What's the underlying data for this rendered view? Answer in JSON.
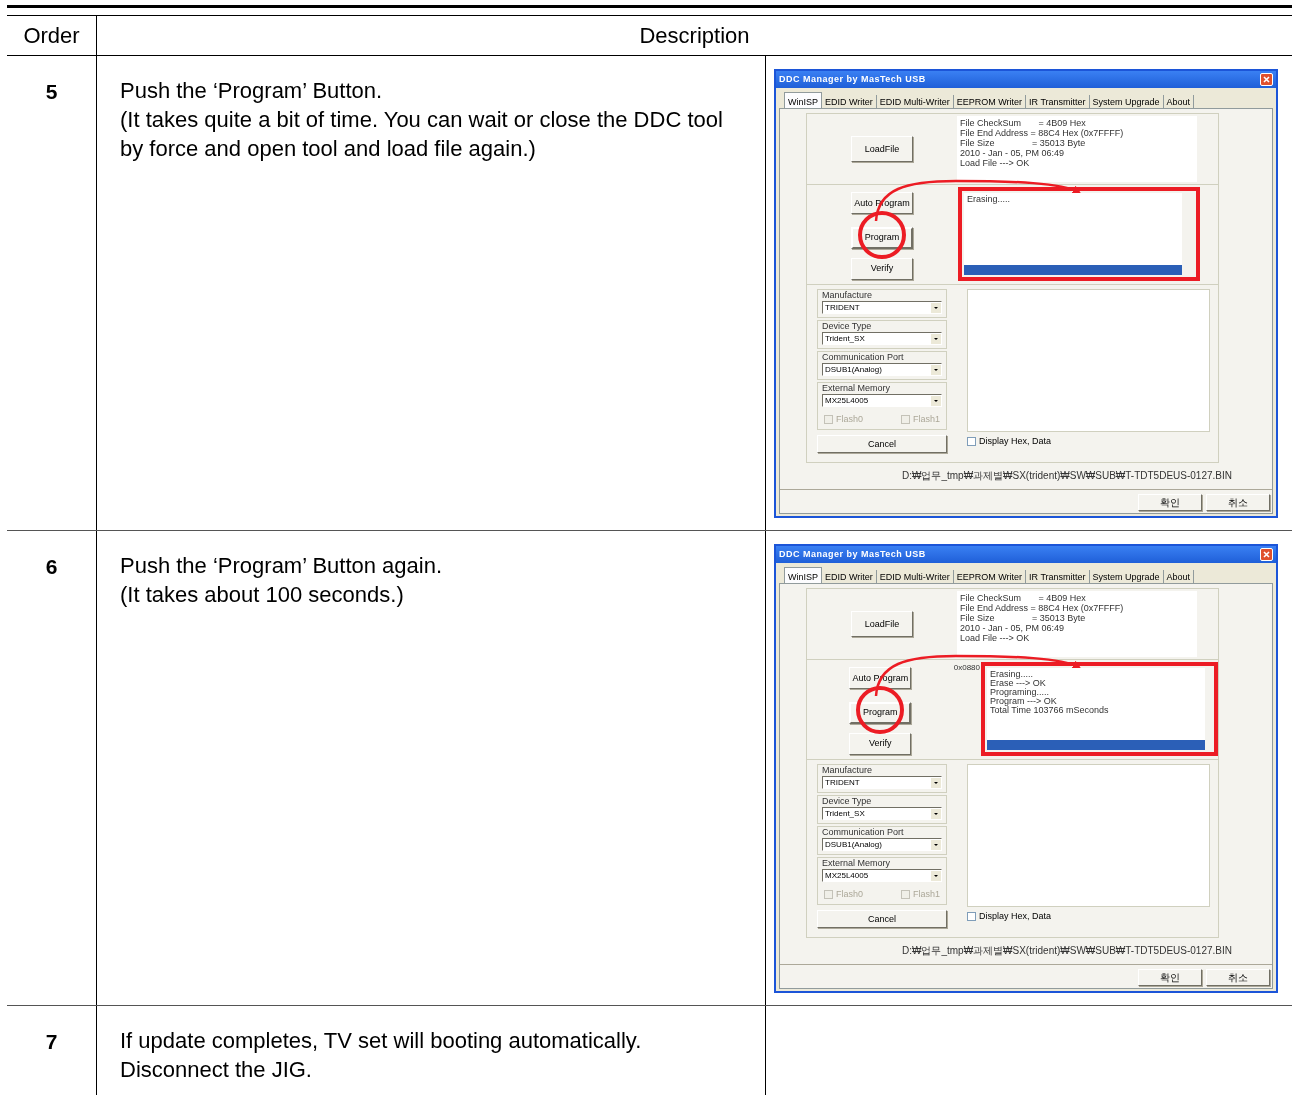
{
  "table": {
    "columns": [
      "Order",
      "Description"
    ],
    "rows": [
      {
        "order": "5",
        "paragraphs": [
          "Push the ‘Program’ Button.",
          "(It takes quite a bit of time. You can wait or close the DDC tool by force and open tool and load file again.)"
        ],
        "dialog": {
          "title": "DDC Manager by MasTech USB",
          "tabs": [
            {
              "label": "WinISP",
              "selected": true
            },
            {
              "label": "EDID Writer",
              "selected": false
            },
            {
              "label": "EDID Multi-Writer",
              "selected": false
            },
            {
              "label": "EEPROM Writer",
              "selected": false
            },
            {
              "label": "IR Transmitter",
              "selected": false
            },
            {
              "label": "System Upgrade",
              "selected": false
            },
            {
              "label": "About",
              "selected": false
            }
          ],
          "load_button": "LoadFile",
          "file_info": [
            "File CheckSum       = 4B09 Hex",
            "File End Address = 88C4 Hex (0x7FFFF)",
            "File Size               = 35013 Byte",
            "2010 - Jan - 05, PM 06:49",
            "Load File ---> OK"
          ],
          "action_buttons": [
            "Auto Program",
            "Program",
            "Verify"
          ],
          "log": [
            "Erasing....."
          ],
          "progress": {
            "level": 1
          },
          "groups": [
            {
              "label": "Manufacture",
              "value": "TRIDENT"
            },
            {
              "label": "Device Type",
              "value": "Trident_SX"
            },
            {
              "label": "Communication Port",
              "value": "DSUB1(Analog)"
            },
            {
              "label": "External Memory",
              "value": "MX25L4005"
            }
          ],
          "flash_options": [
            {
              "label": "Flash0",
              "checked": false,
              "disabled": true
            },
            {
              "label": "Flash1",
              "checked": false,
              "disabled": true
            }
          ],
          "cancel_button": "Cancel",
          "display_hex": {
            "label": "Display Hex, Data",
            "checked": false
          },
          "path": "D:₩업무_tmp₩과제별₩SX(trident)₩SW₩SUB₩T-TDT5DEUS-0127.BIN",
          "footer_buttons": [
            "확인",
            "취소"
          ]
        }
      },
      {
        "order": "6",
        "paragraphs": [
          "Push the ‘Program’ Button again.",
          "(It takes about 100 seconds.)"
        ],
        "dialog": {
          "title": "DDC Manager by MasTech USB",
          "tabs": [
            {
              "label": "WinISP",
              "selected": true
            },
            {
              "label": "EDID Writer",
              "selected": false
            },
            {
              "label": "EDID Multi-Writer",
              "selected": false
            },
            {
              "label": "EEPROM Writer",
              "selected": false
            },
            {
              "label": "IR Transmitter",
              "selected": false
            },
            {
              "label": "System Upgrade",
              "selected": false
            },
            {
              "label": "About",
              "selected": false
            }
          ],
          "load_button": "LoadFile",
          "file_info": [
            "File CheckSum       = 4B09 Hex",
            "File End Address = 88C4 Hex (0x7FFFF)",
            "File Size               = 35013 Byte",
            "2010 - Jan - 05, PM 06:49",
            "Load File ---> OK"
          ],
          "action_buttons": [
            "Auto Program",
            "Program",
            "Verify"
          ],
          "log": [
            "Erasing.....",
            "Erase ---> OK",
            "Programing.....",
            "Program ---> OK",
            "Total Time 103766 mSeconds"
          ],
          "address": "0x0880",
          "progress": {
            "level": 1
          },
          "groups": [
            {
              "label": "Manufacture",
              "value": "TRIDENT"
            },
            {
              "label": "Device Type",
              "value": "Trident_SX"
            },
            {
              "label": "Communication Port",
              "value": "DSUB1(Analog)"
            },
            {
              "label": "External Memory",
              "value": "MX25L4005"
            }
          ],
          "flash_options": [
            {
              "label": "Flash0",
              "checked": false,
              "disabled": true
            },
            {
              "label": "Flash1",
              "checked": false,
              "disabled": true
            }
          ],
          "cancel_button": "Cancel",
          "display_hex": {
            "label": "Display Hex, Data",
            "checked": false
          },
          "path": "D:₩업무_tmp₩과제별₩SX(trident)₩SW₩SUB₩T-TDT5DEUS-0127.BIN",
          "footer_buttons": [
            "확인",
            "취소"
          ]
        }
      },
      {
        "order": "7",
        "paragraphs": [
          "If update completes, TV set will booting automatically. Disconnect the JIG."
        ]
      }
    ]
  }
}
